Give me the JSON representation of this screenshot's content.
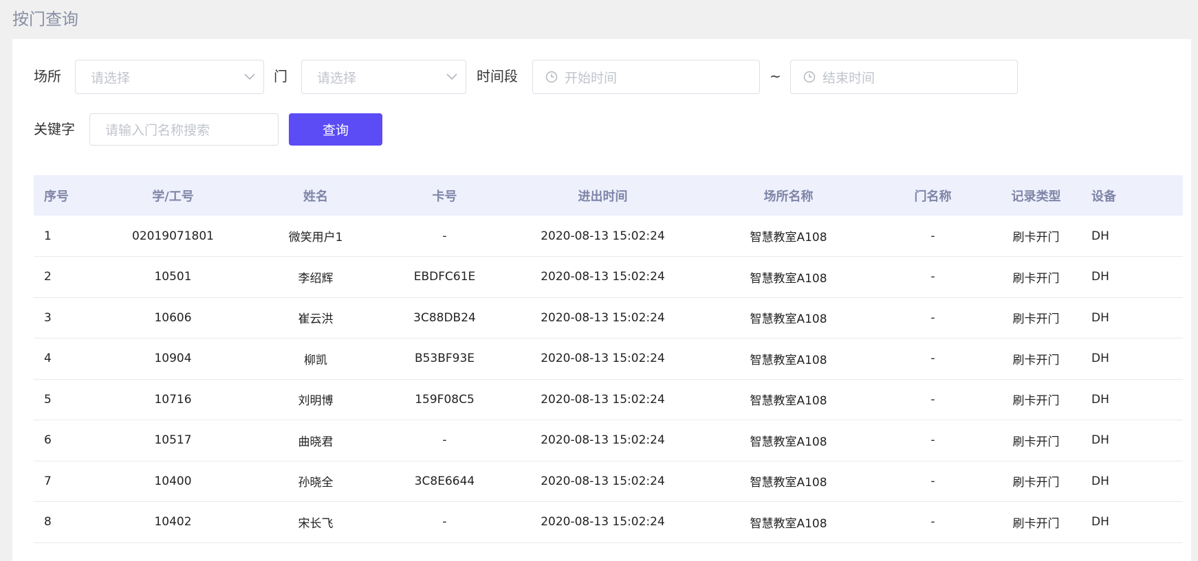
{
  "page": {
    "title": "按门查询"
  },
  "filters": {
    "venue_label": "场所",
    "venue_placeholder": "请选择",
    "door_label": "门",
    "door_placeholder": "请选择",
    "period_label": "时间段",
    "start_placeholder": "开始时间",
    "separator": "~",
    "end_placeholder": "结束时间",
    "keyword_label": "关键字",
    "keyword_placeholder": "请输入门名称搜索",
    "query_button": "查询"
  },
  "table": {
    "headers": [
      "序号",
      "学/工号",
      "姓名",
      "卡号",
      "进出时间",
      "场所名称",
      "门名称",
      "记录类型",
      "设备"
    ],
    "rows": [
      [
        "1",
        "02019071801",
        "微笑用户1",
        "-",
        "2020-08-13 15:02:24",
        "智慧教室A108",
        "-",
        "刷卡开门",
        "DH"
      ],
      [
        "2",
        "10501",
        "李绍辉",
        "EBDFC61E",
        "2020-08-13 15:02:24",
        "智慧教室A108",
        "-",
        "刷卡开门",
        "DH"
      ],
      [
        "3",
        "10606",
        "崔云洪",
        "3C88DB24",
        "2020-08-13 15:02:24",
        "智慧教室A108",
        "-",
        "刷卡开门",
        "DH"
      ],
      [
        "4",
        "10904",
        "柳凯",
        "B53BF93E",
        "2020-08-13 15:02:24",
        "智慧教室A108",
        "-",
        "刷卡开门",
        "DH"
      ],
      [
        "5",
        "10716",
        "刘明博",
        "159F08C5",
        "2020-08-13 15:02:24",
        "智慧教室A108",
        "-",
        "刷卡开门",
        "DH"
      ],
      [
        "6",
        "10517",
        "曲晓君",
        "-",
        "2020-08-13 15:02:24",
        "智慧教室A108",
        "-",
        "刷卡开门",
        "DH"
      ],
      [
        "7",
        "10400",
        "孙晓全",
        "3C8E6644",
        "2020-08-13 15:02:24",
        "智慧教室A108",
        "-",
        "刷卡开门",
        "DH"
      ],
      [
        "8",
        "10402",
        "宋长飞",
        "-",
        "2020-08-13 15:02:24",
        "智慧教室A108",
        "-",
        "刷卡开门",
        "DH"
      ]
    ]
  },
  "colors": {
    "primary": "#5b4cf5",
    "header_bg": "#eef0fc",
    "header_text": "#7f85a7"
  }
}
